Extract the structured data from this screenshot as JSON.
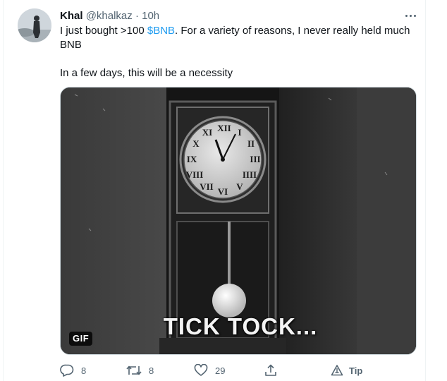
{
  "tweet": {
    "author_name": "Khal",
    "author_handle": "@khalkaz",
    "separator": "·",
    "timestamp": "10h",
    "text_before": "I just bought >100 ",
    "cashtag": "$BNB",
    "text_after": ". For a variety of reasons, I never really held much BNB",
    "text_second": "In a few days, this will be a necessity",
    "media": {
      "badge": "GIF",
      "caption": "TICK TOCK..."
    },
    "actions": {
      "replies": "8",
      "retweets": "8",
      "likes": "29",
      "tip_label": "Tip"
    }
  },
  "icons": {
    "more": "more-horizontal-icon",
    "reply": "reply-icon",
    "retweet": "retweet-icon",
    "like": "heart-icon",
    "share": "share-icon",
    "tip": "tip-icon"
  },
  "colors": {
    "text": "#0f1419",
    "secondary": "#536471",
    "link": "#1d9bf0",
    "border": "#eff3f4"
  }
}
